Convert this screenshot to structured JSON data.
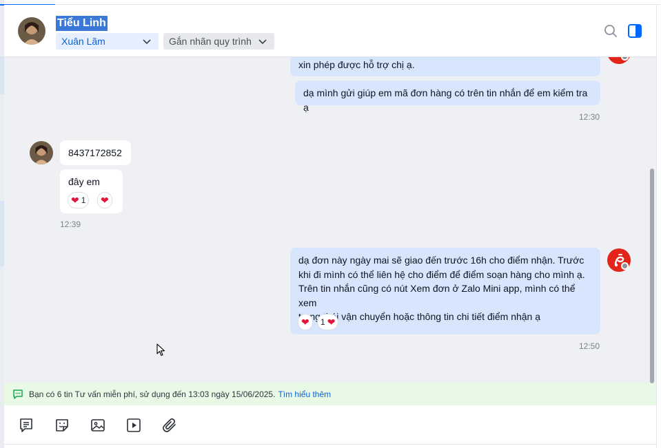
{
  "header": {
    "contact_name": "Tiểu Linh",
    "assignee": "Xuân Lãm",
    "tag_placeholder": "Gắn nhãn quy trình"
  },
  "messages": {
    "out1_text": "xin phép được hỗ trợ chị ạ.",
    "out2_text": "dạ mình gửi giúp em mã đơn hàng có trên tin nhắn để em kiểm tra ạ",
    "out_time1": "12:30",
    "in1_text": "8437172852",
    "in2_text": "đây em",
    "in2_reaction_count": "1",
    "in_time": "12:39",
    "out3_lines": [
      "dạ đơn này ngày mai sẽ giao đến trước 16h cho điểm nhận. Trước",
      "khi đi mình có thể liên hệ cho điểm để điểm soạn hàng cho mình ạ.",
      "Trên tin nhắn cũng có nút Xem đơn ở Zalo Mini app, mình có thể xem",
      "trạng thái vận chuyển hoặc thông tin chi tiết điểm nhận ạ"
    ],
    "out3_reaction_count": "1",
    "out_time2": "12:50"
  },
  "notice": {
    "text": "Bạn có 6 tin Tư vấn miễn phí, sử dụng đến 13:03 ngày 15/06/2025.",
    "link": "Tìm hiểu thêm"
  },
  "icons": {
    "search": "search-icon",
    "panel": "panel-toggle-icon",
    "toolbar": [
      "quick-message-icon",
      "sticker-icon",
      "image-icon",
      "video-icon",
      "attach-icon"
    ]
  },
  "colors": {
    "accent": "#0068ff",
    "outgoing_bubble": "#d7e6fd",
    "chat_bg": "#eef0f4",
    "notice_bg": "#e8fae6",
    "brand_red": "#e1251b"
  }
}
